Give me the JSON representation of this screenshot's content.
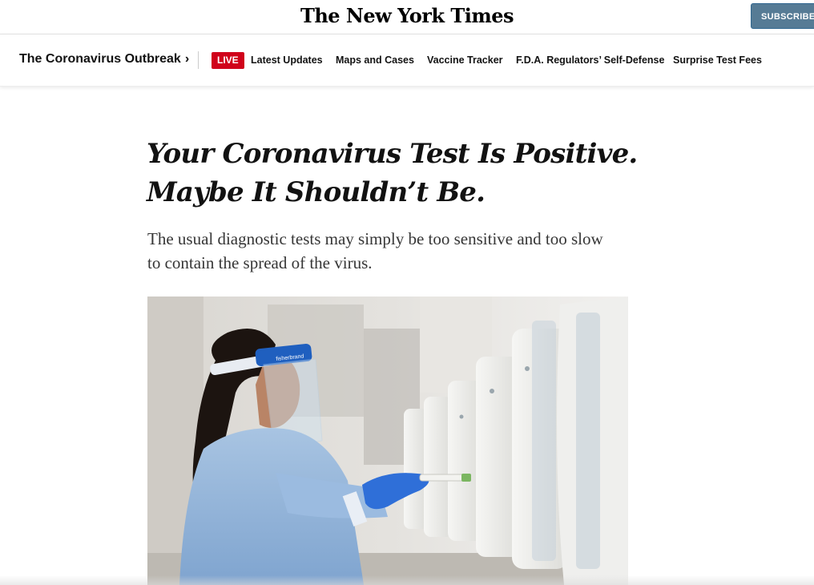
{
  "masthead": {
    "logo_text": "The New York Times",
    "subscribe_label": "SUBSCRIBE"
  },
  "nav": {
    "section_title": "The Coronavirus Outbreak",
    "chevron": "›",
    "live_label": "LIVE",
    "links": [
      "Latest Updates",
      "Maps and Cases",
      "Vaccine Tracker",
      "F.D.A. Regulators’ Self-Defense",
      "Surprise Test Fees"
    ]
  },
  "article": {
    "headline": "Your Coronavirus Test Is Positive. Maybe It Shouldn’t Be.",
    "summary": "The usual diagnostic tests may simply be too sensitive and too slow to contain the spread of the virus.",
    "photo": {
      "face_shield_brand": "fisherbrand"
    }
  },
  "colors": {
    "live_red": "#d0021b",
    "subscribe_blue": "#567b95",
    "text_dark": "#121212",
    "gown_blue": "#8fb3d9",
    "glove_blue": "#2f6fd8"
  },
  "icons": {
    "nav_chevron": "chevron-right-icon"
  }
}
